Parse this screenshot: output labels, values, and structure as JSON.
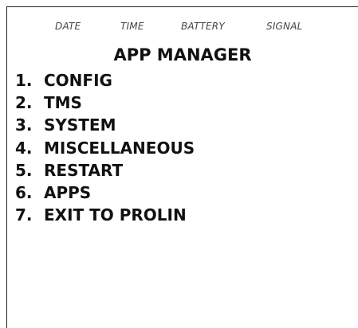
{
  "status_bar": {
    "date": "DATE",
    "time": "TIME",
    "battery": "BATTERY",
    "signal": "SIGNAL"
  },
  "title": "APP MANAGER",
  "menu": {
    "items": [
      {
        "number": "1.",
        "label": "CONFIG"
      },
      {
        "number": "2.",
        "label": "TMS"
      },
      {
        "number": "3.",
        "label": "SYSTEM"
      },
      {
        "number": "4.",
        "label": "MISCELLANEOUS"
      },
      {
        "number": "5.",
        "label": "RESTART"
      },
      {
        "number": "6.",
        "label": "APPS"
      },
      {
        "number": "7.",
        "label": "EXIT TO PROLIN"
      }
    ]
  }
}
